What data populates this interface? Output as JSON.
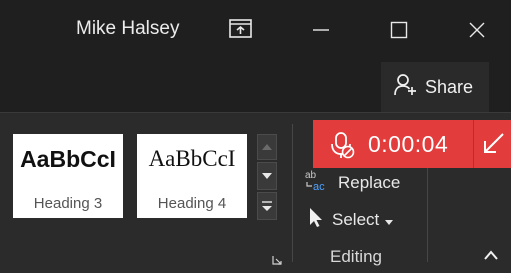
{
  "titlebar": {
    "user_name": "Mike Halsey"
  },
  "share": {
    "label": "Share"
  },
  "styles": [
    {
      "sample": "AaBbCcI",
      "name": "Heading 3"
    },
    {
      "sample": "AaBbCcI",
      "name": "Heading 4"
    }
  ],
  "editing": {
    "replace_label": "Replace",
    "select_label": "Select",
    "group_label": "Editing"
  },
  "recording": {
    "time": "0:00:04"
  },
  "colors": {
    "recording_bar": "#e23c3c",
    "ribbon_bg": "#2b2b2b",
    "titlebar_bg": "#1f1f1f"
  }
}
